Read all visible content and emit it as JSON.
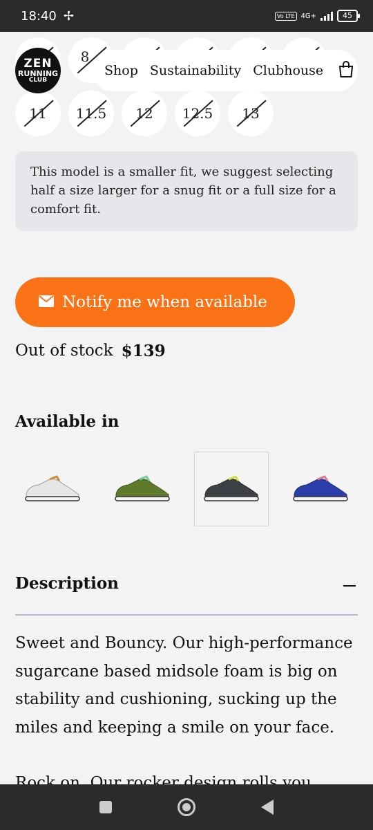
{
  "status_bar": {
    "time": "18:40",
    "network": "4G+",
    "volte": "Vo LTE",
    "battery": "45"
  },
  "brand": {
    "line1": "ZEN",
    "line2": "RUNNING",
    "line3": "CLUB"
  },
  "nav": {
    "shop": "Shop",
    "sustainability": "Sustainability",
    "clubhouse": "Clubhouse"
  },
  "sizes": {
    "top_visible": "8",
    "row2": [
      "11",
      "11.5",
      "12",
      "12.5",
      "13"
    ]
  },
  "fit_note": "This model is a smaller fit, we suggest selecting half a size larger for a snug fit or a full size for a comfort fit.",
  "notify_button": {
    "label": "Notify me when available",
    "color": "#f97316"
  },
  "stock": {
    "status": "Out of stock",
    "price": "$139"
  },
  "available_in": {
    "title": "Available in",
    "variants": [
      {
        "name": "white",
        "upper": "#e6e6e6",
        "accent": "#d08a3a"
      },
      {
        "name": "olive",
        "upper": "#5f7a2a",
        "accent": "#6fd1a0"
      },
      {
        "name": "charcoal",
        "upper": "#3d4044",
        "accent": "#d4e040",
        "selected": true
      },
      {
        "name": "blue",
        "upper": "#2b3eaa",
        "accent": "#e07a8a"
      }
    ]
  },
  "description": {
    "title": "Description",
    "paragraphs": [
      "Sweet and Bouncy. Our high-performance sugarcane based midsole foam is big on stability and cushioning, sucking up the miles and keeping a smile on your face.",
      "Rock on. Our rocker design rolls you"
    ]
  }
}
